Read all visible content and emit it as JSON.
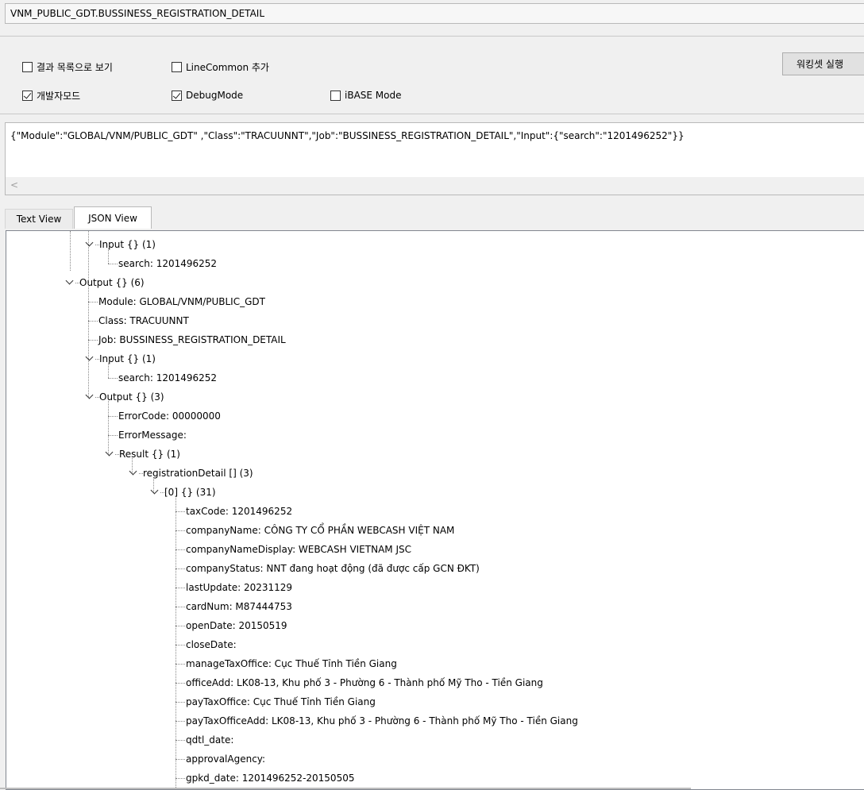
{
  "path_label": "VNM_PUBLIC_GDT.BUSSINESS_REGISTRATION_DETAIL",
  "options": {
    "view_as_list": "결과 목록으로 보기",
    "view_as_list_checked": false,
    "line_common_add": "LineCommon 추가",
    "line_common_add_checked": false,
    "dev_mode": "개발자모드",
    "dev_mode_checked": true,
    "debug_mode": "DebugMode",
    "debug_mode_checked": true,
    "ibase_mode": "iBASE Mode",
    "ibase_mode_checked": false,
    "run_button": "워킹셋 실행"
  },
  "request_json": "{\"Module\":\"GLOBAL/VNM/PUBLIC_GDT\" ,\"Class\":\"TRACUUNNT\",\"Job\":\"BUSSINESS_REGISTRATION_DETAIL\",\"Input\":{\"search\":\"1201496252\"}}",
  "scroll_left_glyph": "<",
  "tabs": {
    "text_view": "Text View",
    "json_view": "JSON View",
    "active": "JSON View"
  },
  "tree": [
    {
      "depth": 3,
      "node": "Input {} (1)",
      "expanded": true
    },
    {
      "depth": 4,
      "node": "search: 1201496252"
    },
    {
      "depth": 2,
      "node": "Output {} (6)",
      "expanded": true
    },
    {
      "depth": 3,
      "node": "Module: GLOBAL/VNM/PUBLIC_GDT"
    },
    {
      "depth": 3,
      "node": "Class: TRACUUNNT"
    },
    {
      "depth": 3,
      "node": "Job: BUSSINESS_REGISTRATION_DETAIL"
    },
    {
      "depth": 3,
      "node": "Input {} (1)",
      "expanded": true
    },
    {
      "depth": 4,
      "node": "search: 1201496252"
    },
    {
      "depth": 3,
      "node": "Output {} (3)",
      "expanded": true
    },
    {
      "depth": 4,
      "node": "ErrorCode: 00000000"
    },
    {
      "depth": 4,
      "node": "ErrorMessage:"
    },
    {
      "depth": 4,
      "node": "Result {} (1)",
      "expanded": true
    },
    {
      "depth": 5,
      "node": "registrationDetail [] (3)",
      "expanded": true
    },
    {
      "depth": 6,
      "node": "[0] {} (31)",
      "expanded": true
    },
    {
      "depth": 7,
      "node": "taxCode: 1201496252"
    },
    {
      "depth": 7,
      "node": "companyName: CÔNG TY CỔ PHẦN WEBCASH VIỆT NAM"
    },
    {
      "depth": 7,
      "node": "companyNameDisplay: WEBCASH VIETNAM JSC"
    },
    {
      "depth": 7,
      "node": "companyStatus: NNT đang hoạt động (đã được cấp GCN ĐKT)"
    },
    {
      "depth": 7,
      "node": "lastUpdate: 20231129"
    },
    {
      "depth": 7,
      "node": "cardNum: M87444753"
    },
    {
      "depth": 7,
      "node": "openDate: 20150519"
    },
    {
      "depth": 7,
      "node": "closeDate:"
    },
    {
      "depth": 7,
      "node": "manageTaxOffice: Cục Thuế Tỉnh Tiền Giang"
    },
    {
      "depth": 7,
      "node": "officeAdd: LK08-13, Khu phố 3 - Phường 6 - Thành phố Mỹ Tho - Tiền Giang"
    },
    {
      "depth": 7,
      "node": "payTaxOffice: Cục Thuế Tỉnh Tiền Giang"
    },
    {
      "depth": 7,
      "node": "payTaxOfficeAdd: LK08-13, Khu phố 3 - Phường 6 - Thành phố Mỹ Tho - Tiền Giang"
    },
    {
      "depth": 7,
      "node": "qdtl_date:"
    },
    {
      "depth": 7,
      "node": "approvalAgency:"
    },
    {
      "depth": 7,
      "node": "gpkd_date: 1201496252-20150505"
    }
  ]
}
